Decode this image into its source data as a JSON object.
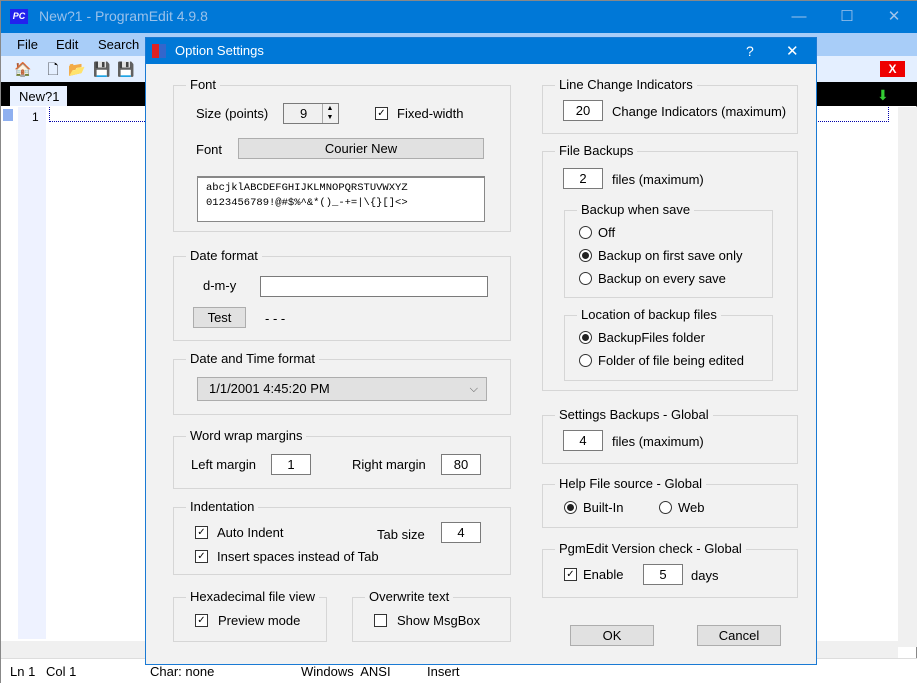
{
  "window": {
    "title": "New?1  -  ProgramEdit 4.9.8",
    "logo": "PC",
    "minimize": "—",
    "maximize": "☐",
    "close": "✕"
  },
  "menu": [
    "File",
    "Edit",
    "Search"
  ],
  "toolbar": {
    "icons": [
      "home-icon",
      "new-file-icon",
      "open-folder-icon",
      "save-icon",
      "save-all-icon"
    ],
    "close_label": "X"
  },
  "tabs": [
    {
      "label": "New?1"
    }
  ],
  "editor": {
    "line_number": "1"
  },
  "status": {
    "line": "Ln 1",
    "col": "Col 1",
    "char": "Char: none",
    "encoding": "Windows  ANSI",
    "mode": "Insert"
  },
  "dialog": {
    "title": "Option Settings",
    "help": "?",
    "close": "✕",
    "font": {
      "group": "Font",
      "size_label": "Size (points)",
      "size_value": "9",
      "fixed_width_label": "Fixed-width",
      "fixed_width_checked": true,
      "font_label": "Font",
      "font_button": "Courier New",
      "preview_line1": "abcjklABCDEFGHIJKLMNOPQRSTUVWXYZ",
      "preview_line2": "0123456789!@#$%^&*()_-+=|\\{}[]<>"
    },
    "date_format": {
      "group": "Date format",
      "label": "d-m-y",
      "value": "",
      "test_button": "Test",
      "result": "- - -"
    },
    "date_time_format": {
      "group": "Date and Time format",
      "selected": "1/1/2001 4:45:20 PM"
    },
    "word_wrap": {
      "group": "Word wrap margins",
      "left_label": "Left margin",
      "left_value": "1",
      "right_label": "Right margin",
      "right_value": "80"
    },
    "indentation": {
      "group": "Indentation",
      "auto_indent_label": "Auto Indent",
      "auto_indent": true,
      "tab_size_label": "Tab size",
      "tab_size": "4",
      "spaces_label": "Insert spaces instead of Tab",
      "spaces": true
    },
    "hex_view": {
      "group": "Hexadecimal file view",
      "preview_label": "Preview mode",
      "preview": true
    },
    "overwrite": {
      "group": "Overwrite text",
      "msgbox_label": "Show MsgBox",
      "msgbox": false
    },
    "line_change": {
      "group": "Line Change Indicators",
      "value": "20",
      "label": "Change Indicators (maximum)"
    },
    "file_backups": {
      "group": "File Backups",
      "value": "2",
      "label": "files (maximum)",
      "when_group": "Backup when save",
      "when_options": [
        "Off",
        "Backup on first save only",
        "Backup on every save"
      ],
      "when_selected": 1,
      "location_group": "Location of backup files",
      "location_options": [
        "BackupFiles folder",
        "Folder of file being edited"
      ],
      "location_selected": 0
    },
    "settings_backups": {
      "group": "Settings Backups - Global",
      "value": "4",
      "label": "files (maximum)"
    },
    "help_source": {
      "group": "Help File source - Global",
      "options": [
        "Built-In",
        "Web"
      ],
      "selected": 0
    },
    "version_check": {
      "group": "PgmEdit Version check - Global",
      "enable_label": "Enable",
      "enabled": true,
      "value": "5",
      "days_label": "days"
    },
    "ok": "OK",
    "cancel": "Cancel"
  }
}
